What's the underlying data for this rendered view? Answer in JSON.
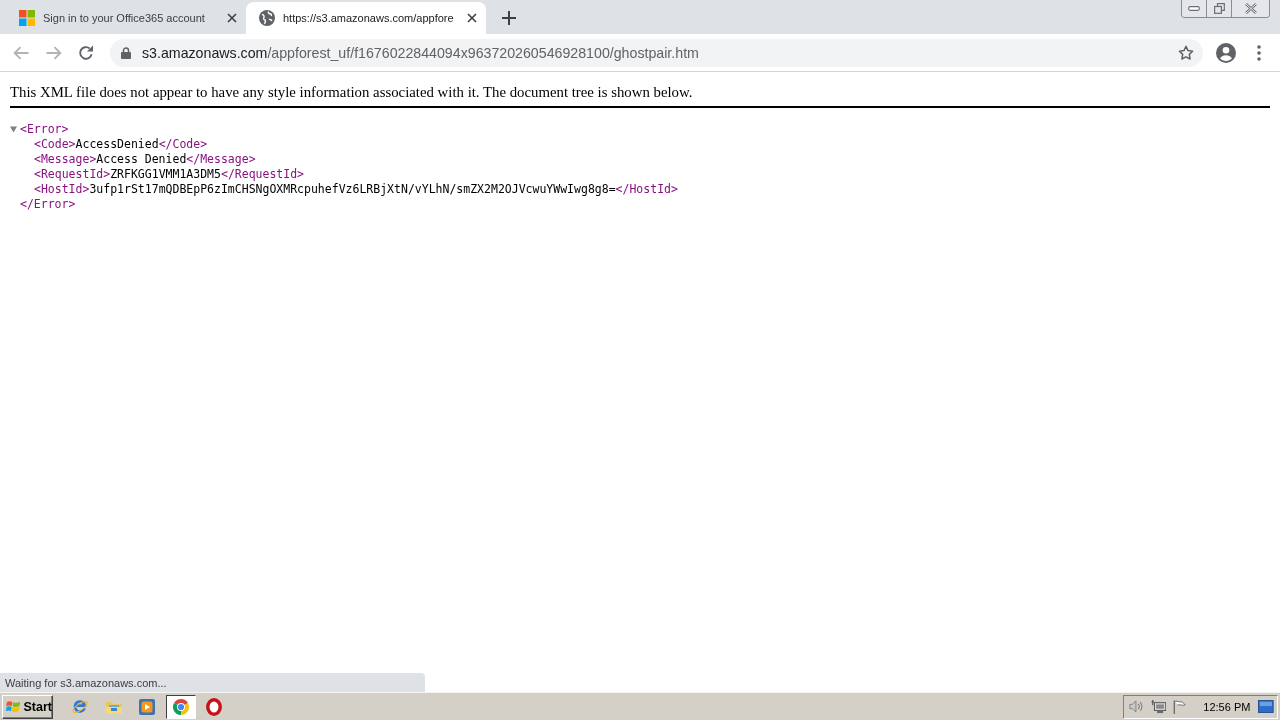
{
  "tabs": [
    {
      "kind": "microsoft",
      "title": "Sign in to your Office365 account",
      "selected": false
    },
    {
      "kind": "globe",
      "title": "https://s3.amazonaws.com/appfore",
      "selected": true
    }
  ],
  "address_bar": {
    "host": "s3.amazonaws.com",
    "path": "/appforest_uf/f1676022844094x963720260546928100/ghostpair.htm"
  },
  "page": {
    "notice": "This XML file does not appear to have any style information associated with it. The document tree is shown below.",
    "xml_tree": {
      "open": "<Error>",
      "close": "</Error>",
      "expanded": true,
      "children": [
        {
          "open": "<Code>",
          "text": "AccessDenied",
          "close": "</Code>"
        },
        {
          "open": "<Message>",
          "text": "Access Denied",
          "close": "</Message>"
        },
        {
          "open": "<RequestId>",
          "text": "ZRFKGG1VMM1A3DM5",
          "close": "</RequestId>"
        },
        {
          "open": "<HostId>",
          "text": "3ufp1rSt17mQDBEpP6zImCHSNgOXMRcpuhefVz6LRBjXtN/vYLhN/smZX2M2OJVcwuYWwIwg8g8=",
          "close": "</HostId>"
        }
      ]
    }
  },
  "status_bubble": "Waiting for s3.amazonaws.com...",
  "taskbar": {
    "start": "Start",
    "apps": [
      {
        "kind": "ie",
        "selected": false
      },
      {
        "kind": "explorer",
        "selected": false
      },
      {
        "kind": "media",
        "selected": false
      },
      {
        "kind": "chrome",
        "selected": true
      },
      {
        "kind": "opera",
        "selected": false
      }
    ],
    "clock": "12:56 PM"
  }
}
